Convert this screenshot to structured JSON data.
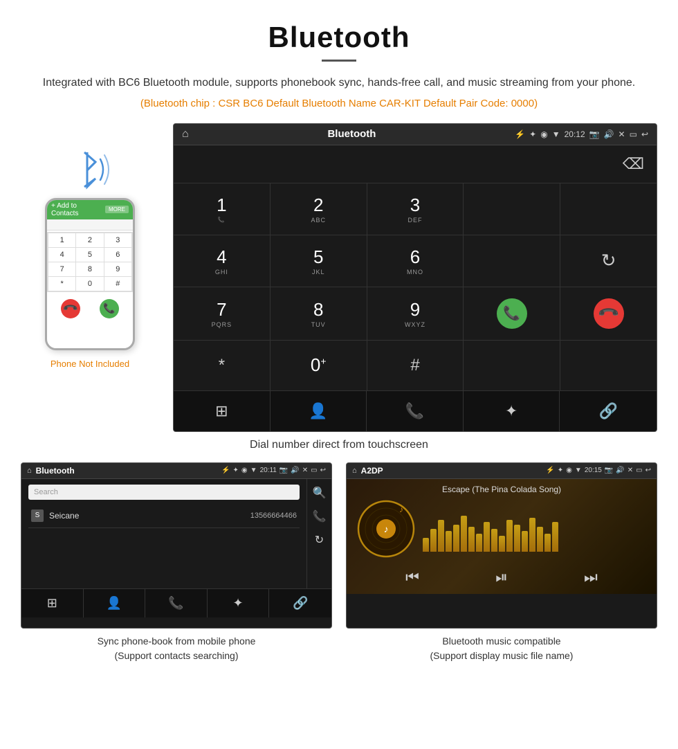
{
  "header": {
    "title": "Bluetooth",
    "description": "Integrated with BC6 Bluetooth module, supports phonebook sync, hands-free call, and music streaming from your phone.",
    "specs": "(Bluetooth chip : CSR BC6    Default Bluetooth Name CAR-KIT    Default Pair Code: 0000)"
  },
  "car_dial_screen": {
    "status_bar": {
      "label": "Bluetooth",
      "time": "20:12"
    },
    "keypad": [
      {
        "num": "1",
        "letters": ""
      },
      {
        "num": "2",
        "letters": "ABC"
      },
      {
        "num": "3",
        "letters": "DEF"
      },
      {
        "num": "",
        "letters": ""
      },
      {
        "num": "⌫",
        "letters": ""
      },
      {
        "num": "4",
        "letters": "GHI"
      },
      {
        "num": "5",
        "letters": "JKL"
      },
      {
        "num": "6",
        "letters": "MNO"
      },
      {
        "num": "",
        "letters": ""
      },
      {
        "num": "↻",
        "letters": ""
      },
      {
        "num": "7",
        "letters": "PQRS"
      },
      {
        "num": "8",
        "letters": "TUV"
      },
      {
        "num": "9",
        "letters": "WXYZ"
      },
      {
        "num": "☎",
        "letters": ""
      },
      {
        "num": "☎end",
        "letters": ""
      },
      {
        "num": "*",
        "letters": ""
      },
      {
        "num": "0",
        "letters": "+"
      },
      {
        "num": "#",
        "letters": ""
      },
      {
        "num": "",
        "letters": ""
      },
      {
        "num": "",
        "letters": ""
      }
    ],
    "caption": "Dial number direct from touchscreen"
  },
  "phone_mockup": {
    "not_included_label": "Phone Not Included",
    "dial_keys": [
      "1",
      "2",
      "3",
      "4",
      "5",
      "6",
      "7",
      "8",
      "9",
      "*",
      "0",
      "#"
    ]
  },
  "phonebook_screen": {
    "status_bar": {
      "label": "Bluetooth",
      "time": "20:11"
    },
    "search_placeholder": "Search",
    "contacts": [
      {
        "initial": "S",
        "name": "Seicane",
        "number": "13566664466"
      }
    ],
    "caption_line1": "Sync phone-book from mobile phone",
    "caption_line2": "(Support contacts searching)"
  },
  "music_screen": {
    "status_bar": {
      "label": "A2DP",
      "time": "20:15"
    },
    "song_title": "Escape (The Pina Colada Song)",
    "caption_line1": "Bluetooth music compatible",
    "caption_line2": "(Support display music file name)",
    "viz_bars": [
      30,
      50,
      70,
      45,
      60,
      80,
      55,
      40,
      65,
      50,
      35,
      70,
      60,
      45,
      75,
      55,
      40,
      65
    ]
  }
}
